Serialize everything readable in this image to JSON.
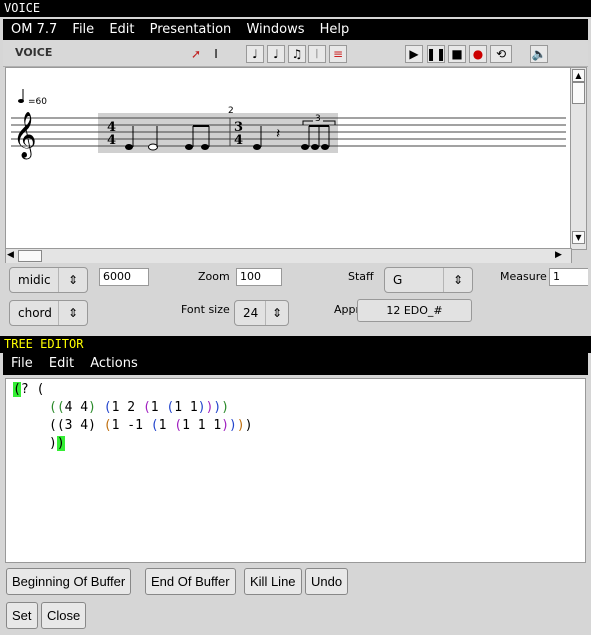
{
  "voice_window": {
    "title": "VOICE",
    "menus": [
      "OM 7.7",
      "File",
      "Edit",
      "Presentation",
      "Windows",
      "Help"
    ],
    "panel_label": "VOICE",
    "score": {
      "tempo": "=60",
      "measure_number": "2",
      "time_signatures": [
        {
          "num": "4",
          "den": "4"
        },
        {
          "num": "3",
          "den": "4"
        }
      ],
      "tuplet_label": "3"
    },
    "controls": {
      "display_select": "midic",
      "display_value": "6000",
      "zoom_label": "Zoom",
      "zoom_value": "100",
      "staff_label": "Staff",
      "staff_value": "G",
      "measure_label": "Measure",
      "measure_value": "1",
      "mode_select": "chord",
      "font_size_label": "Font size",
      "font_size_value": "24",
      "approx_label": "Approx",
      "approx_value": "12 EDO_#"
    },
    "transport_colors": {
      "record": "#cc0000"
    }
  },
  "tree_editor": {
    "title": "TREE EDITOR",
    "menus": [
      "File",
      "Edit",
      "Actions"
    ],
    "buttons": {
      "beginning": "Beginning Of Buffer",
      "end": "End Of Buffer",
      "kill": "Kill Line",
      "undo": "Undo",
      "set": "Set",
      "close": "Close"
    }
  }
}
